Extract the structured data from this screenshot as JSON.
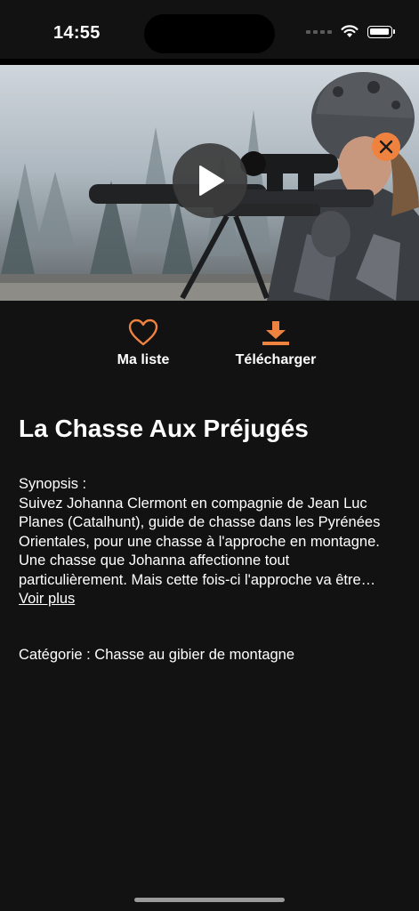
{
  "status": {
    "time": "14:55"
  },
  "hero": {
    "play_icon": "play-icon",
    "close_icon": "close-icon",
    "accent": "#f08240"
  },
  "actions": {
    "my_list": {
      "label": "Ma liste",
      "icon": "heart-icon"
    },
    "download": {
      "label": "Télécharger",
      "icon": "download-icon"
    }
  },
  "video": {
    "title": "La Chasse Aux Préjugés",
    "synopsis_heading": "Synopsis :",
    "synopsis_text": "Suivez Johanna Clermont en compagnie de Jean Luc Planes (Catalhunt), guide de chasse dans les Pyrénées Orientales, pour une chasse à l'approche en montagne. Une chasse que Johanna affectionne tout particulièrement. Mais cette fois-ci l'approche va être particulièrement technique. Malgré de gros efforts…",
    "see_more": "Voir plus",
    "category": "Catégorie : Chasse au gibier de montagne"
  }
}
